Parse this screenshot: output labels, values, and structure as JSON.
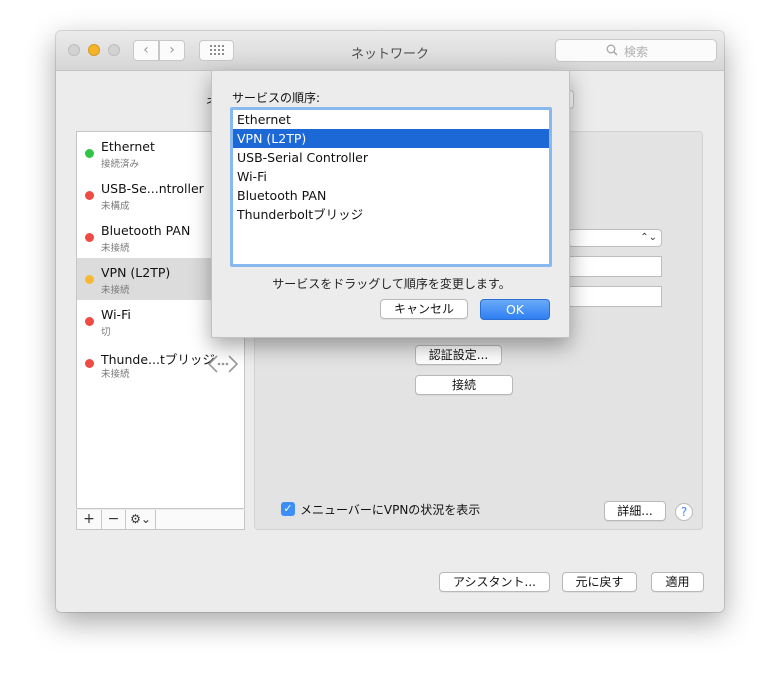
{
  "window": {
    "title": "ネットワーク",
    "search_placeholder": "検索"
  },
  "background": {
    "partial_label": "ネ"
  },
  "services": [
    {
      "name": "Ethernet",
      "status": "接続済み",
      "dot_color": "#2fc547"
    },
    {
      "name": "USB-Se...ntroller",
      "status": "未構成",
      "dot_color": "#f04a45"
    },
    {
      "name": "Bluetooth PAN",
      "status": "未接続",
      "dot_color": "#f04a45"
    },
    {
      "name": "VPN (L2TP)",
      "status": "未接続",
      "dot_color": "#f7b731"
    },
    {
      "name": "Wi-Fi",
      "status": "切",
      "dot_color": "#f04a45"
    },
    {
      "name": "Thunde...tブリッジ",
      "status": "未接続",
      "dot_color": "#f04a45"
    }
  ],
  "sidebar_tools": {
    "add": "+",
    "remove": "−",
    "gear": "⚙⌄"
  },
  "vpn_panel": {
    "auth_button": "認証設定...",
    "connect_button": "接続",
    "show_status_checkbox": "メニューバーにVPNの状況を表示",
    "show_status_checked": true,
    "advanced_button": "詳細...",
    "help": "?"
  },
  "footer": {
    "assistant_button": "アシスタント...",
    "revert_button": "元に戻す",
    "apply_button": "適用"
  },
  "dialog": {
    "title": "サービスの順序:",
    "items": [
      "Ethernet",
      "VPN (L2TP)",
      "USB-Serial Controller",
      "Wi-Fi",
      "Bluetooth PAN",
      "Thunderboltブリッジ"
    ],
    "selected_index": 1,
    "hint": "サービスをドラッグして順序を変更します。",
    "cancel_button": "キャンセル",
    "ok_button": "OK"
  },
  "colors": {
    "accent": "#3d8ef6",
    "selection": "#1c68d6"
  }
}
